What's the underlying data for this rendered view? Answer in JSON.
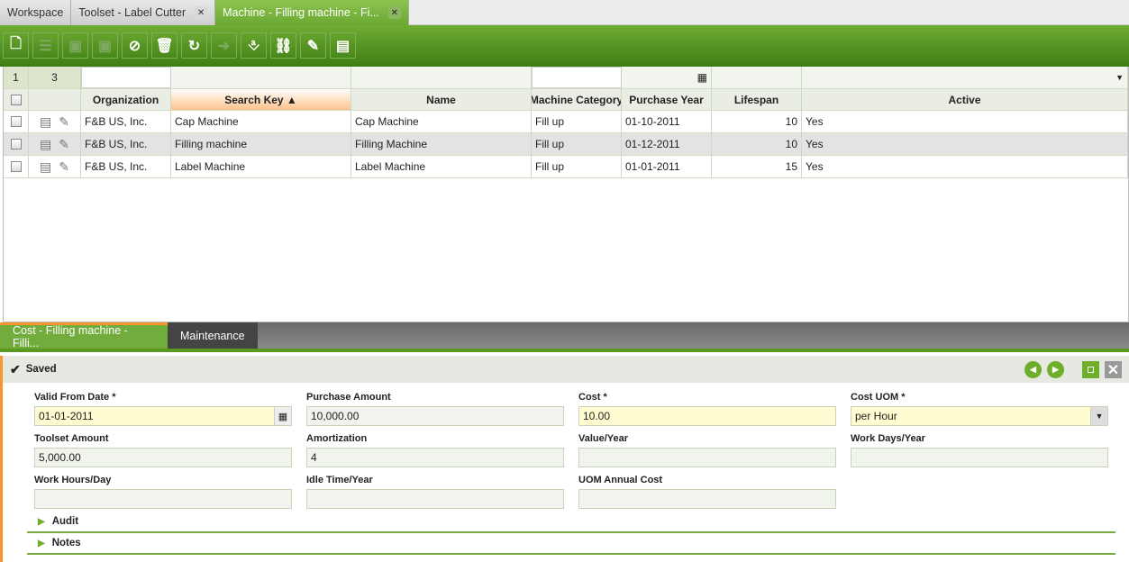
{
  "tabs": [
    {
      "label": "Workspace"
    },
    {
      "label": "Toolset - Label Cutter"
    },
    {
      "label": "Machine - Filling machine - Fi..."
    }
  ],
  "toolbar": [
    "new-icon",
    "grid-toggle-icon",
    "save-icon",
    "save-close-icon",
    "undo-icon",
    "delete-icon",
    "refresh-icon",
    "export-icon",
    "attach-icon",
    "link-icon",
    "customize-icon",
    "layout-icon"
  ],
  "grid": {
    "page": "1",
    "count": "3",
    "headers": [
      "Organization",
      "Search Key ▲",
      "Name",
      "Machine Category",
      "Purchase Year",
      "Lifespan",
      "Active"
    ],
    "rows": [
      [
        "F&B US, Inc.",
        "Cap Machine",
        "Cap Machine",
        "Fill up",
        "01-10-2011",
        "10",
        "Yes"
      ],
      [
        "F&B US, Inc.",
        "Filling machine",
        "Filling Machine",
        "Fill up",
        "01-12-2011",
        "10",
        "Yes"
      ],
      [
        "F&B US, Inc.",
        "Label Machine",
        "Label Machine",
        "Fill up",
        "01-01-2011",
        "15",
        "Yes"
      ]
    ]
  },
  "detail_tabs": [
    "Cost - Filling machine - Filli...",
    "Maintenance"
  ],
  "status": "Saved",
  "fields": [
    {
      "label": "Valid From Date *",
      "value": "01-01-2011"
    },
    {
      "label": "Purchase Amount",
      "value": "10,000.00"
    },
    {
      "label": "Cost *",
      "value": "10.00"
    },
    {
      "label": "Cost UOM *",
      "value": "per Hour"
    },
    {
      "label": "Toolset Amount",
      "value": "5,000.00"
    },
    {
      "label": "Amortization",
      "value": "4"
    },
    {
      "label": "Value/Year",
      "value": ""
    },
    {
      "label": "Work Days/Year",
      "value": ""
    },
    {
      "label": "Work Hours/Day",
      "value": ""
    },
    {
      "label": "Idle Time/Year",
      "value": ""
    },
    {
      "label": "UOM Annual Cost",
      "value": ""
    }
  ],
  "sections": [
    "Audit",
    "Notes"
  ]
}
